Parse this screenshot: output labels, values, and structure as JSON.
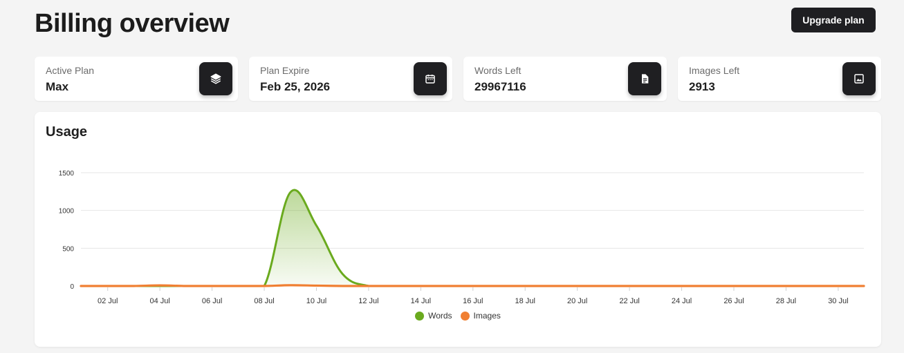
{
  "header": {
    "title": "Billing overview",
    "upgrade_label": "Upgrade plan"
  },
  "stats": [
    {
      "label": "Active Plan",
      "value": "Max",
      "icon": "layers-icon"
    },
    {
      "label": "Plan Expire",
      "value": "Feb 25, 2026",
      "icon": "calendar-icon"
    },
    {
      "label": "Words Left",
      "value": "29967116",
      "icon": "document-icon"
    },
    {
      "label": "Images Left",
      "value": "2913",
      "icon": "image-icon"
    }
  ],
  "usage": {
    "title": "Usage"
  },
  "colors": {
    "words": "#6aaa1e",
    "images": "#f07f32",
    "dark": "#1f1f22"
  },
  "chart_data": {
    "type": "area",
    "x": [
      "01 Jul",
      "02 Jul",
      "03 Jul",
      "04 Jul",
      "05 Jul",
      "06 Jul",
      "07 Jul",
      "08 Jul",
      "09 Jul",
      "10 Jul",
      "11 Jul",
      "12 Jul",
      "13 Jul",
      "14 Jul",
      "15 Jul",
      "16 Jul",
      "17 Jul",
      "18 Jul",
      "19 Jul",
      "20 Jul",
      "21 Jul",
      "22 Jul",
      "23 Jul",
      "24 Jul",
      "25 Jul",
      "26 Jul",
      "27 Jul",
      "28 Jul",
      "29 Jul",
      "30 Jul",
      "31 Jul"
    ],
    "x_ticks": [
      "02 Jul",
      "04 Jul",
      "06 Jul",
      "08 Jul",
      "10 Jul",
      "12 Jul",
      "14 Jul",
      "16 Jul",
      "18 Jul",
      "20 Jul",
      "22 Jul",
      "24 Jul",
      "26 Jul",
      "28 Jul",
      "30 Jul"
    ],
    "series": [
      {
        "name": "Words",
        "values": [
          0,
          0,
          0,
          0,
          0,
          0,
          0,
          0,
          1240,
          800,
          160,
          0,
          0,
          0,
          0,
          0,
          0,
          0,
          0,
          0,
          0,
          0,
          0,
          0,
          0,
          0,
          0,
          0,
          0,
          0,
          0
        ]
      },
      {
        "name": "Images",
        "values": [
          0,
          0,
          0,
          8,
          0,
          0,
          0,
          0,
          10,
          5,
          0,
          0,
          0,
          0,
          0,
          0,
          0,
          0,
          0,
          0,
          0,
          0,
          0,
          0,
          0,
          0,
          0,
          0,
          0,
          0,
          0
        ]
      }
    ],
    "y_ticks": [
      0,
      500,
      1000,
      1500
    ],
    "ylim": [
      0,
      1500
    ],
    "grid": true,
    "legend": "bottom-center"
  }
}
